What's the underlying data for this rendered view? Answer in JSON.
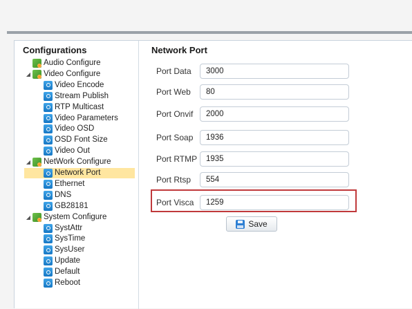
{
  "sidebar": {
    "title": "Configurations",
    "tree": [
      {
        "label": "Audio Configure",
        "type": "folder",
        "icon": "folder-gear-icon",
        "expanded": false
      },
      {
        "label": "Video Configure",
        "type": "folder",
        "icon": "folder-gear-icon",
        "expanded": true
      },
      {
        "label": "Video Encode",
        "type": "leaf",
        "icon": "settings-icon"
      },
      {
        "label": "Stream Publish",
        "type": "leaf",
        "icon": "settings-icon"
      },
      {
        "label": "RTP Multicast",
        "type": "leaf",
        "icon": "settings-icon"
      },
      {
        "label": "Video Parameters",
        "type": "leaf",
        "icon": "settings-icon"
      },
      {
        "label": "Video OSD",
        "type": "leaf",
        "icon": "settings-icon"
      },
      {
        "label": "OSD Font Size",
        "type": "leaf",
        "icon": "settings-icon"
      },
      {
        "label": "Video Out",
        "type": "leaf",
        "icon": "settings-icon"
      },
      {
        "label": "NetWork Configure",
        "type": "folder",
        "icon": "folder-gear-icon",
        "expanded": true
      },
      {
        "label": "Network Port",
        "type": "leaf",
        "icon": "settings-icon",
        "selected": true
      },
      {
        "label": "Ethernet",
        "type": "leaf",
        "icon": "settings-icon"
      },
      {
        "label": "DNS",
        "type": "leaf",
        "icon": "settings-icon"
      },
      {
        "label": "GB28181",
        "type": "leaf",
        "icon": "settings-icon"
      },
      {
        "label": "System Configure",
        "type": "folder",
        "icon": "folder-gear-icon",
        "expanded": true
      },
      {
        "label": "SystAttr",
        "type": "leaf",
        "icon": "settings-icon"
      },
      {
        "label": "SysTime",
        "type": "leaf",
        "icon": "settings-icon"
      },
      {
        "label": "SysUser",
        "type": "leaf",
        "icon": "settings-icon"
      },
      {
        "label": "Update",
        "type": "leaf",
        "icon": "settings-icon"
      },
      {
        "label": "Default",
        "type": "leaf",
        "icon": "settings-icon"
      },
      {
        "label": "Reboot",
        "type": "leaf",
        "icon": "settings-icon"
      }
    ]
  },
  "main": {
    "title": "Network Port",
    "fields": [
      {
        "label": "Port Data",
        "value": "3000"
      },
      {
        "label": "Port Web",
        "value": "80"
      },
      {
        "label": "Port Onvif",
        "value": "2000"
      },
      {
        "label": "Port Soap",
        "value": "1936"
      },
      {
        "label": "Port RTMP",
        "value": "1935"
      },
      {
        "label": "Port Rtsp",
        "value": "554"
      },
      {
        "label": "Port Visca",
        "value": "1259",
        "highlighted": true
      }
    ],
    "save_label": "Save"
  },
  "colors": {
    "selected_bg": "#ffe6a0",
    "highlight_border": "#c0393b",
    "accent_blue": "#2d7fd3"
  }
}
